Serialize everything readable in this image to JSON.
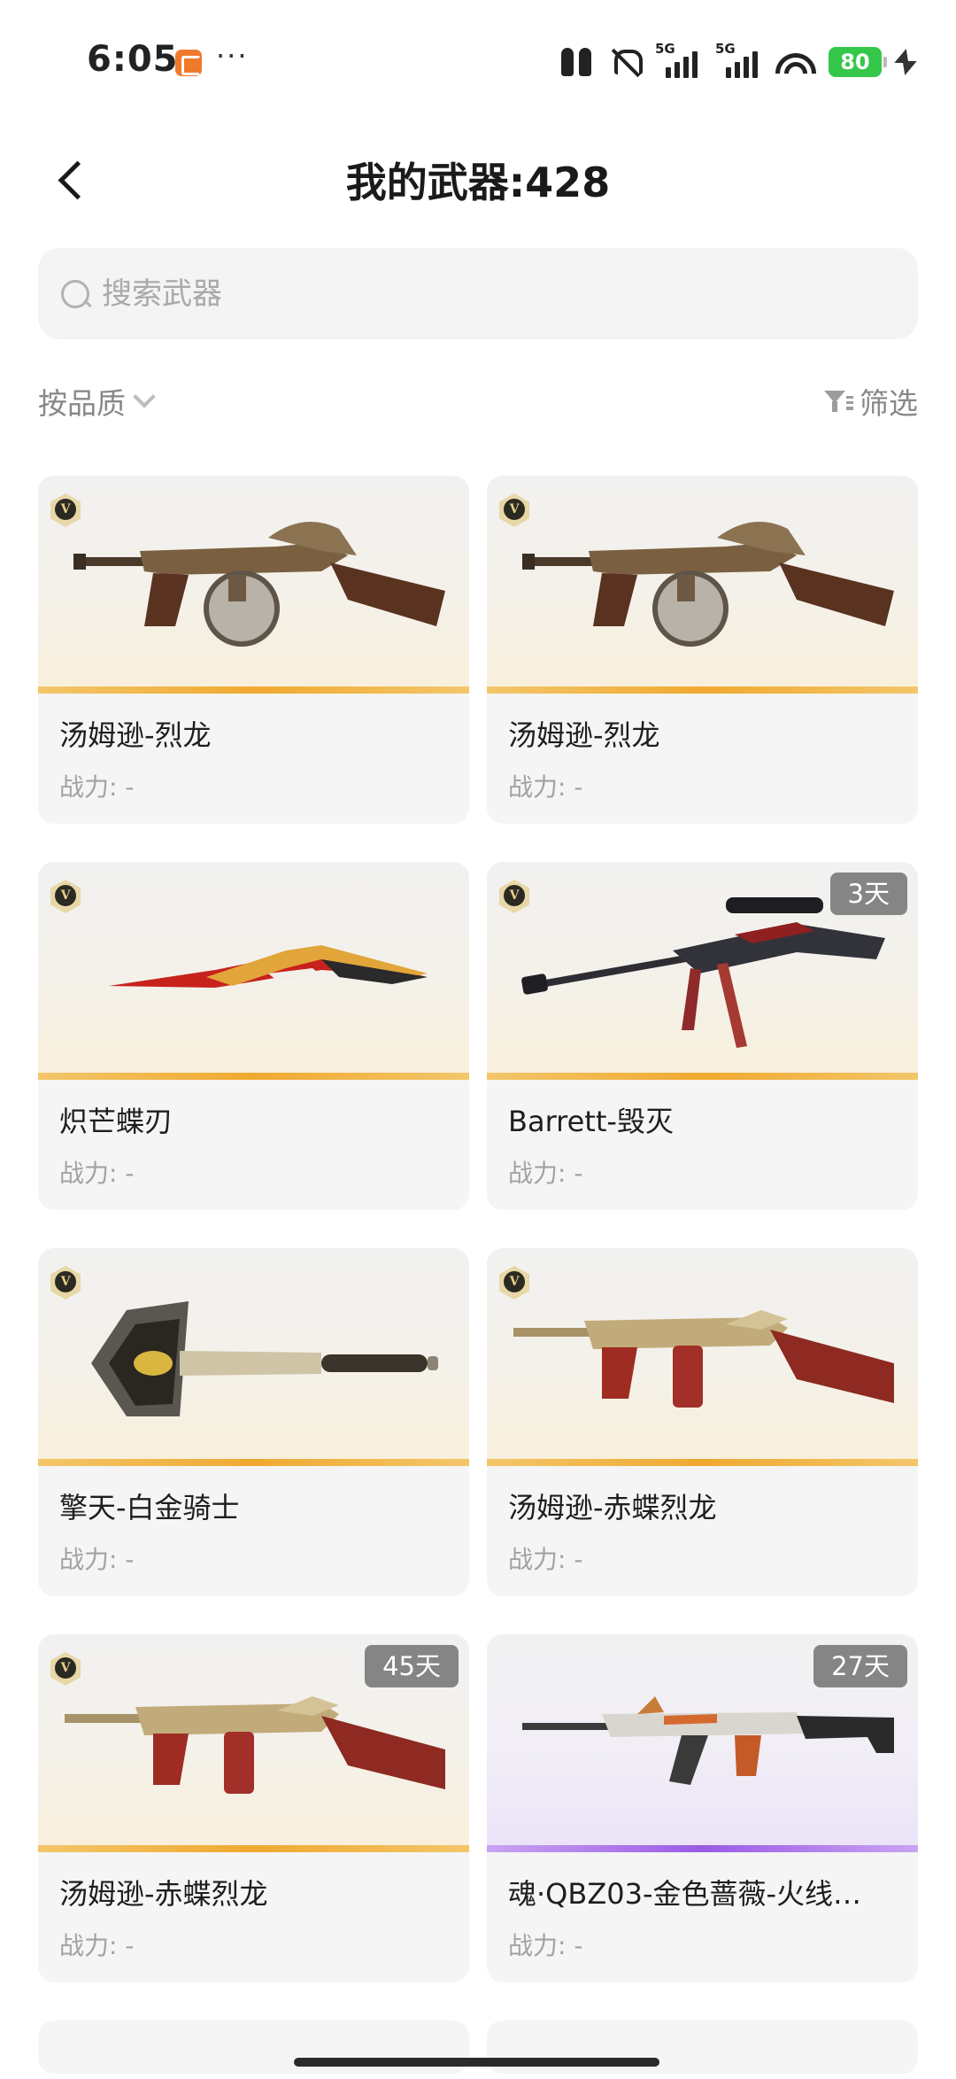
{
  "status_bar": {
    "time": "6:05",
    "signal_1_label": "5G",
    "signal_2_label": "5G",
    "battery": "80"
  },
  "header": {
    "title": "我的武器:428"
  },
  "search": {
    "placeholder": "搜索武器"
  },
  "toolbar": {
    "sort_label": "按品质",
    "filter_label": "筛选"
  },
  "weapons": [
    {
      "name": "汤姆逊-烈龙",
      "power": "战力: -",
      "badge": "V",
      "days": "",
      "rarity_color": "#f0a930",
      "icon": "tommy-gun-dragon-icon"
    },
    {
      "name": "汤姆逊-烈龙",
      "power": "战力: -",
      "badge": "V",
      "days": "",
      "rarity_color": "#f0a930",
      "icon": "tommy-gun-dragon-icon"
    },
    {
      "name": "炽芒蝶刃",
      "power": "战力: -",
      "badge": "V",
      "days": "",
      "rarity_color": "#f0a930",
      "icon": "butterfly-blade-icon"
    },
    {
      "name": "Barrett-毁灭",
      "power": "战力: -",
      "badge": "V",
      "days": "3天",
      "rarity_color": "#f0a930",
      "icon": "sniper-rifle-icon"
    },
    {
      "name": "擎天-白金骑士",
      "power": "战力: -",
      "badge": "V",
      "days": "",
      "rarity_color": "#f0a930",
      "icon": "shovel-axe-icon"
    },
    {
      "name": "汤姆逊-赤蝶烈龙",
      "power": "战力: -",
      "badge": "V",
      "days": "",
      "rarity_color": "#f0a930",
      "icon": "tommy-gun-red-icon"
    },
    {
      "name": "汤姆逊-赤蝶烈龙",
      "power": "战力: -",
      "badge": "V",
      "days": "45天",
      "rarity_color": "#f0a930",
      "icon": "tommy-gun-red-icon"
    },
    {
      "name": "魂·QBZ03-金色蔷薇-火线…",
      "power": "战力: -",
      "badge": "",
      "days": "27天",
      "rarity_color": "#9a5ae6",
      "icon": "assault-rifle-icon"
    }
  ]
}
